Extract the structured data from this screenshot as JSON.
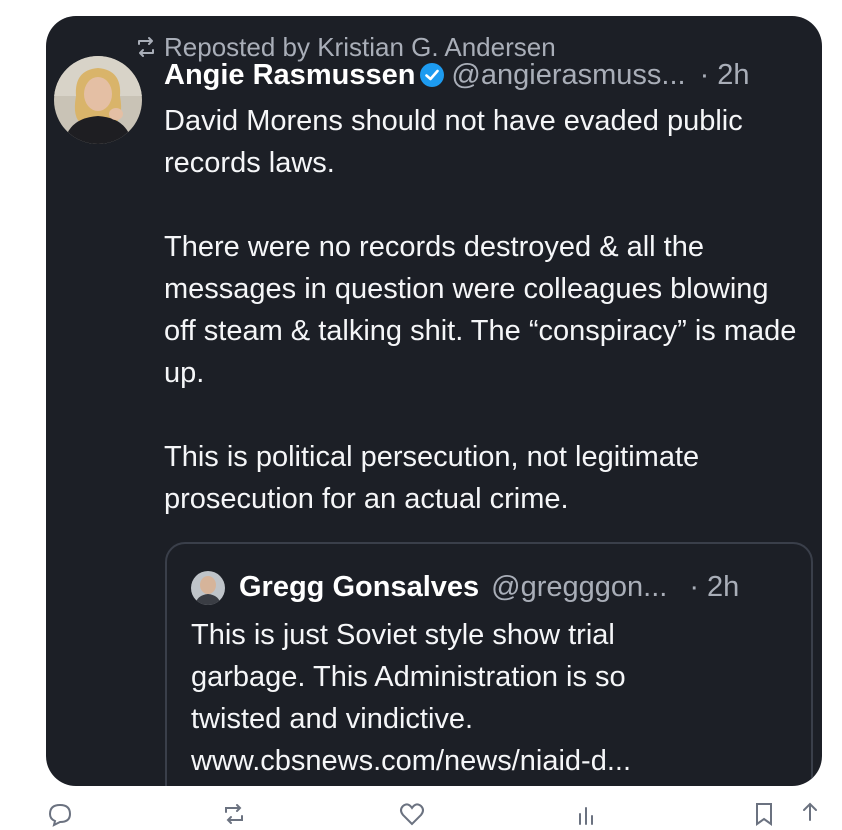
{
  "repost": {
    "icon": "repost-icon",
    "text": "Reposted by Kristian G. Andersen"
  },
  "post": {
    "author": "Angie Rasmussen",
    "verified_icon": "verified-badge-icon",
    "handle": "@angierasmuss...",
    "time": "· 2h",
    "paragraphs": [
      "David Morens should not have evaded public records laws.",
      "There were no records destroyed & all the messages in question were colleagues blowing off steam & talking shit. The “conspiracy” is made up.",
      "This is political persecution, not legitimate prosecution for an actual crime."
    ]
  },
  "quote": {
    "author": "Gregg Gonsalves",
    "handle": "@gregggon...",
    "time": "· 2h",
    "lines": [
      "This is just Soviet style show trial",
      "garbage. This Administration is so",
      "twisted and vindictive.",
      "www.cbsnews.com/news/niaid-d..."
    ]
  },
  "actions": {
    "reply_icon": "reply-icon",
    "repost_icon": "repost-icon",
    "like_icon": "heart-icon",
    "views_icon": "views-icon",
    "bookmark_icon": "bookmark-icon",
    "share_icon": "share-icon"
  },
  "colors": {
    "card_bg": "#1c1f26",
    "accent_verified": "#1d9bf0",
    "secondary_text": "#a9aeb8"
  }
}
